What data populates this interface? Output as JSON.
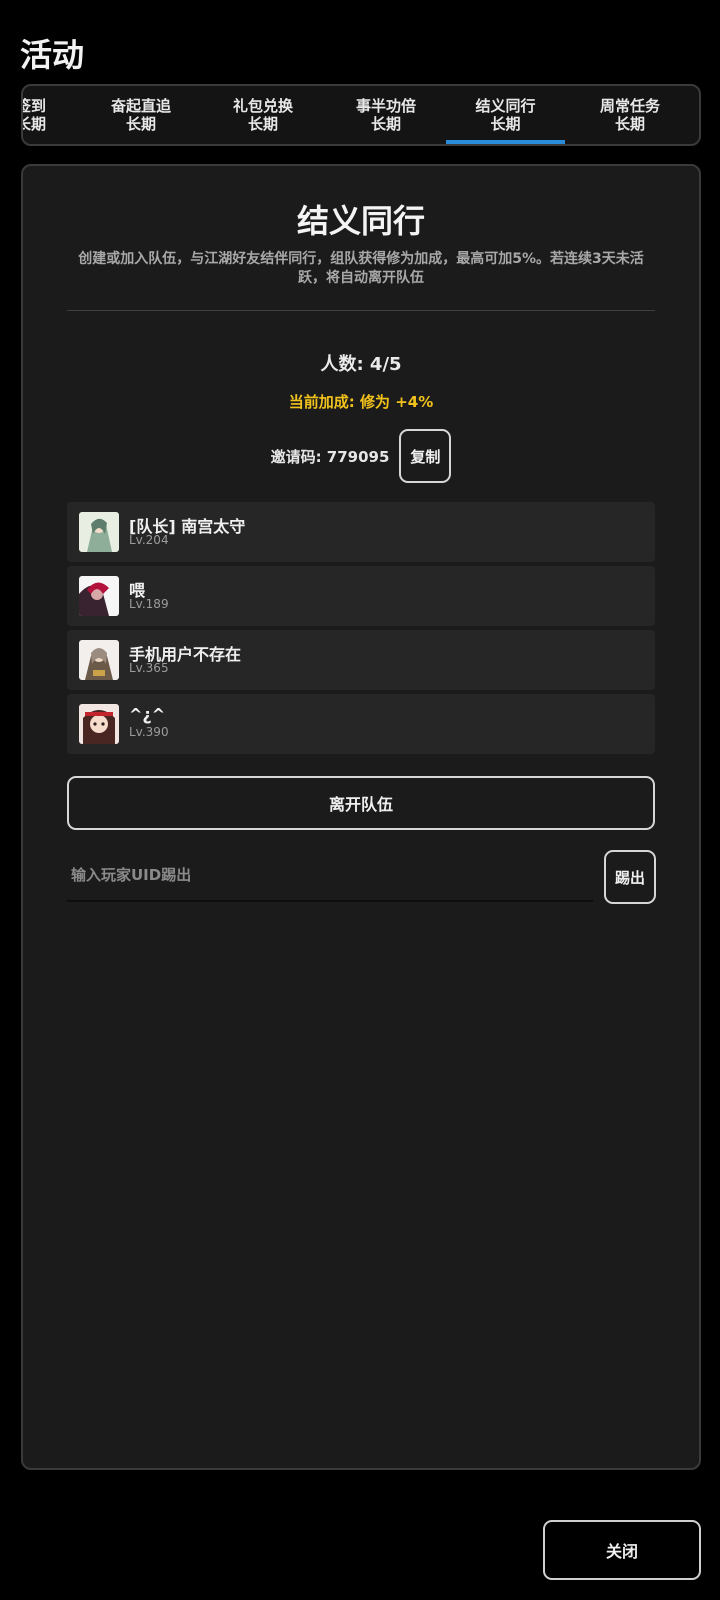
{
  "header": {
    "title": "活动"
  },
  "tabs": [
    {
      "label": "签到",
      "sub": "长期",
      "active": false
    },
    {
      "label": "奋起直追",
      "sub": "长期",
      "active": false
    },
    {
      "label": "礼包兑换",
      "sub": "长期",
      "active": false
    },
    {
      "label": "事半功倍",
      "sub": "长期",
      "active": false
    },
    {
      "label": "结义同行",
      "sub": "长期",
      "active": true
    },
    {
      "label": "周常任务",
      "sub": "长期",
      "active": false
    }
  ],
  "panel": {
    "title": "结义同行",
    "description": "创建或加入队伍，与江湖好友结伴同行，组队获得修为加成，最高可加5%。若连续3天未活跃，将自动离开队伍",
    "member_count": "人数: 4/5",
    "bonus": "当前加成: 修为 +4%",
    "invite_code": "邀请码: 779095",
    "copy_label": "复制",
    "members": [
      {
        "name": "[队长] 南宫太守",
        "level": "Lv.204"
      },
      {
        "name": "喂",
        "level": "Lv.189"
      },
      {
        "name": "手机用户不存在",
        "level": "Lv.365"
      },
      {
        "name": "^¿^",
        "level": "Lv.390"
      }
    ],
    "leave_label": "离开队伍",
    "kick_placeholder": "输入玩家UID踢出",
    "kick_label": "踢出"
  },
  "footer": {
    "close_label": "关闭"
  },
  "colors": {
    "accent": "#2a8cd8",
    "bonus": "#f2c21c"
  }
}
